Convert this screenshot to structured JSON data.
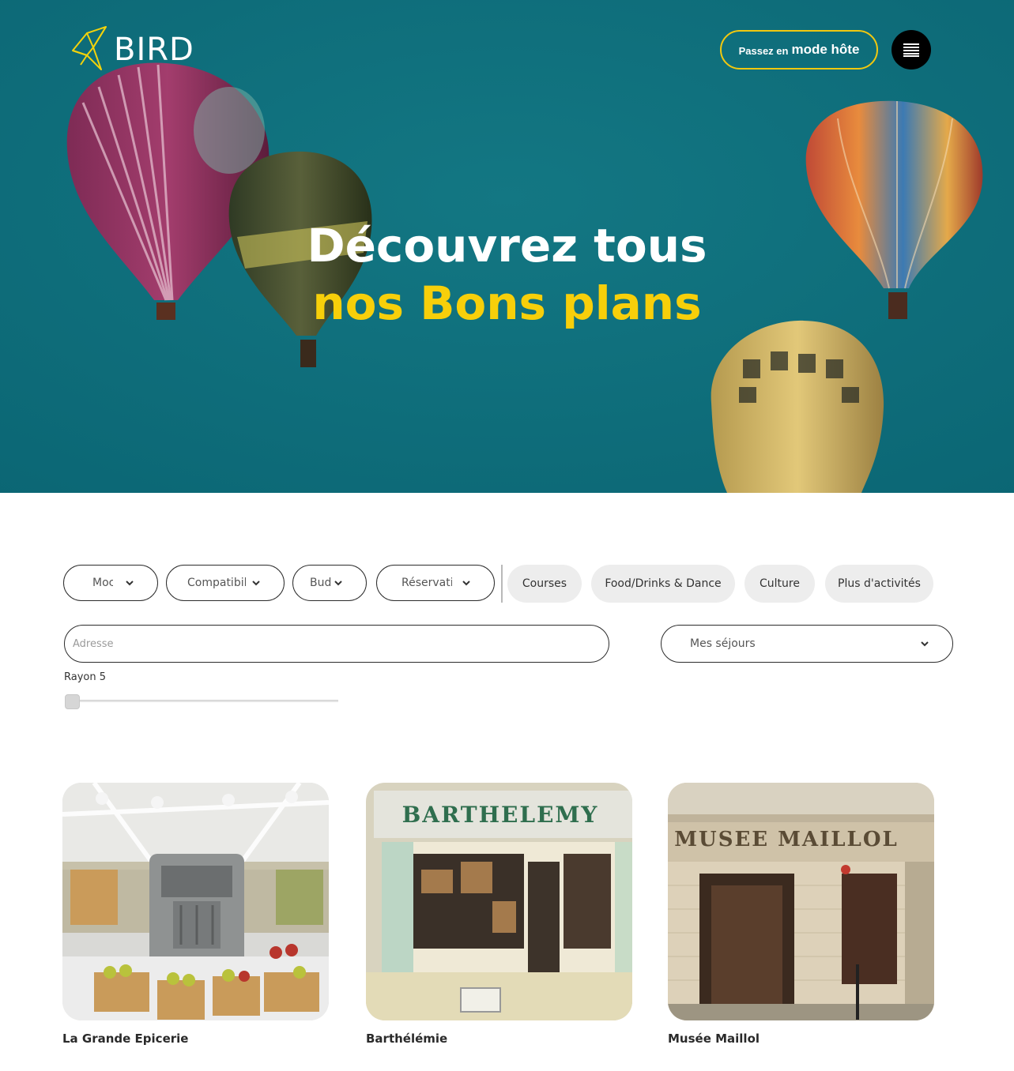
{
  "header": {
    "logo_text": "BIRD",
    "host_button_prefix": "Passez en",
    "host_button_main": "mode hôte",
    "menu_icon": "menu-icon"
  },
  "hero": {
    "title_line1": "Découvrez tous",
    "title_line2": "nos Bons plans",
    "accent_color": "#f7cf0a"
  },
  "filters": {
    "dropdowns": [
      {
        "label": "Moc"
      },
      {
        "label": "Compatibili"
      },
      {
        "label": "Bud"
      },
      {
        "label": "Réservatio"
      }
    ],
    "chips": [
      {
        "label": "Courses"
      },
      {
        "label": "Food/Drinks & Dance"
      },
      {
        "label": "Culture"
      },
      {
        "label": "Plus d'activités"
      }
    ]
  },
  "search": {
    "address_placeholder": "Adresse",
    "sejours_label": "Mes séjours",
    "rayon_label": "Rayon 5"
  },
  "cards": [
    {
      "name": "La Grande Epicerie"
    },
    {
      "name": "Barthélémie"
    },
    {
      "name": "Musée Maillol"
    }
  ]
}
